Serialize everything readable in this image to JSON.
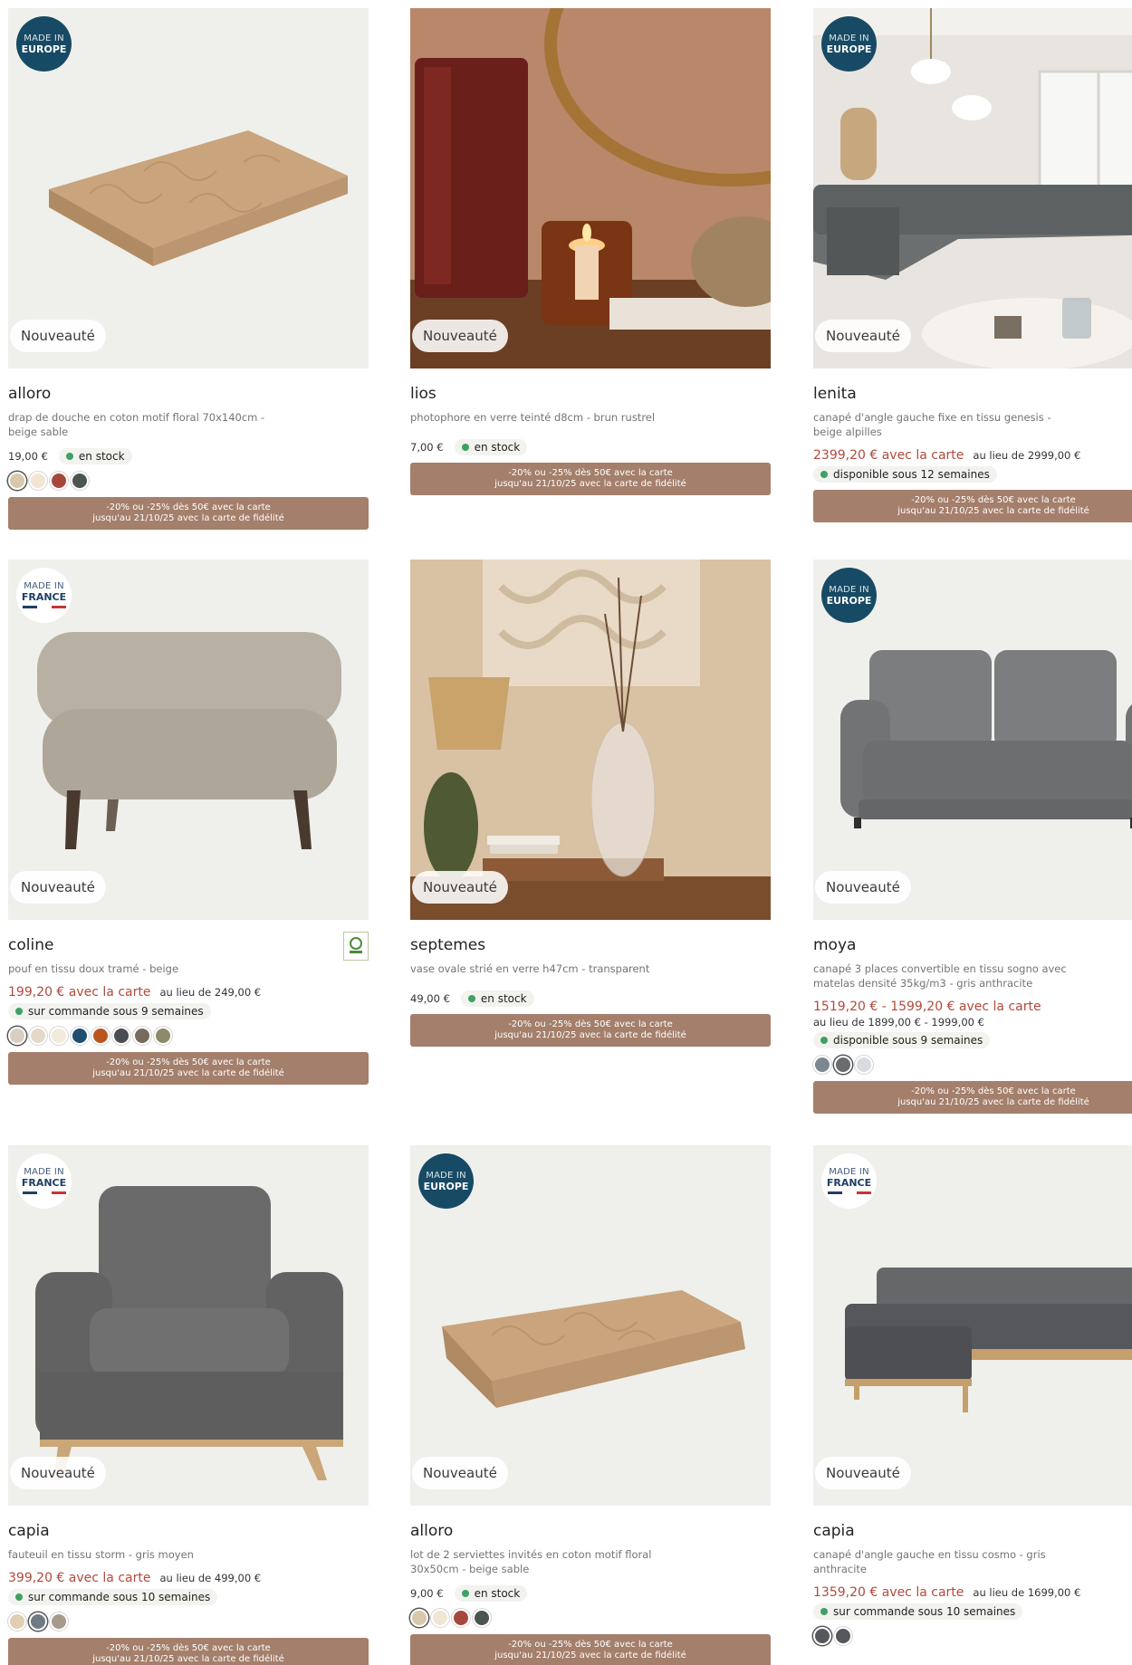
{
  "labels": {
    "new": "Nouveauté",
    "in_stock": "en stock",
    "made_in": "MADE IN",
    "europe": "EUROPE",
    "france": "FRANCE"
  },
  "promo": {
    "line1": "-20% ou -25% dès 50€ avec la carte",
    "line2": "jusqu'au 21/10/25 avec la carte de fidélité"
  },
  "products": [
    {
      "name": "alloro",
      "desc": "drap de douche en coton motif floral 70x140cm - beige sable",
      "price": "19,00 €",
      "stock": "en stock",
      "badge": "europe",
      "swatches": [
        "#d8c9ad",
        "#f1e6d3",
        "#a7473c",
        "#4c5550"
      ]
    },
    {
      "name": "lios",
      "desc": "photophore en verre teinté d8cm - brun rustrel",
      "price": "7,00 €",
      "stock": "en stock"
    },
    {
      "name": "lenita",
      "desc": "canapé d'angle gauche fixe en tissu genesis - beige alpilles",
      "sale": "2399,20 € avec la carte",
      "was": "au lieu de 2999,00 €",
      "stock": "disponible sous 12 semaines",
      "badge": "europe"
    },
    {
      "name": "coline",
      "desc": "pouf en tissu doux tramé - beige",
      "sale": "199,20 € avec la carte",
      "was": "au lieu de 249,00 €",
      "stock": "sur commande sous 9 semaines",
      "badge": "france",
      "swatches": [
        "#d9cfc0",
        "#e6d8c7",
        "#f2eadb",
        "#1f4e70",
        "#b9561f",
        "#4a4e54",
        "#786a5d",
        "#8c8a68"
      ]
    },
    {
      "name": "septemes",
      "desc": "vase ovale strié en verre h47cm - transparent",
      "price": "49,00 €",
      "stock": "en stock"
    },
    {
      "name": "moya",
      "desc": "canapé 3 places convertible en tissu sogno avec matelas densité 35kg/m3 - gris anthracite",
      "sale": "1519,20 € - 1599,20 € avec la carte",
      "was": "au lieu de 1899,00 € - 1999,00 €",
      "stock": "disponible sous 9 semaines",
      "badge": "europe",
      "swatches": [
        "#7d8791",
        "#6a6c6e",
        "#d9dcdf"
      ]
    },
    {
      "name": "capia",
      "desc": "fauteuil en tissu storm - gris moyen",
      "sale": "399,20 € avec la carte",
      "was": "au lieu de 499,00 €",
      "stock": "sur commande sous 10 semaines",
      "badge": "france",
      "swatches": [
        "#e0cfb2",
        "#6f7a83",
        "#a89a8b"
      ]
    },
    {
      "name": "alloro",
      "desc": "lot de 2 serviettes invités en coton motif floral 30x50cm - beige sable",
      "price": "9,00 €",
      "stock": "en stock",
      "badge": "europe",
      "swatches": [
        "#d8c9ad",
        "#f1e6d3",
        "#a7473c",
        "#4c5550"
      ]
    },
    {
      "name": "capia",
      "desc": "canapé d'angle gauche en tissu cosmo - gris anthracite",
      "sale": "1359,20 € avec la carte",
      "was": "au lieu de 1699,00 €",
      "stock": "sur commande sous 10 semaines",
      "badge": "france",
      "swatches": [
        "#56595c",
        "#55585a"
      ]
    }
  ]
}
